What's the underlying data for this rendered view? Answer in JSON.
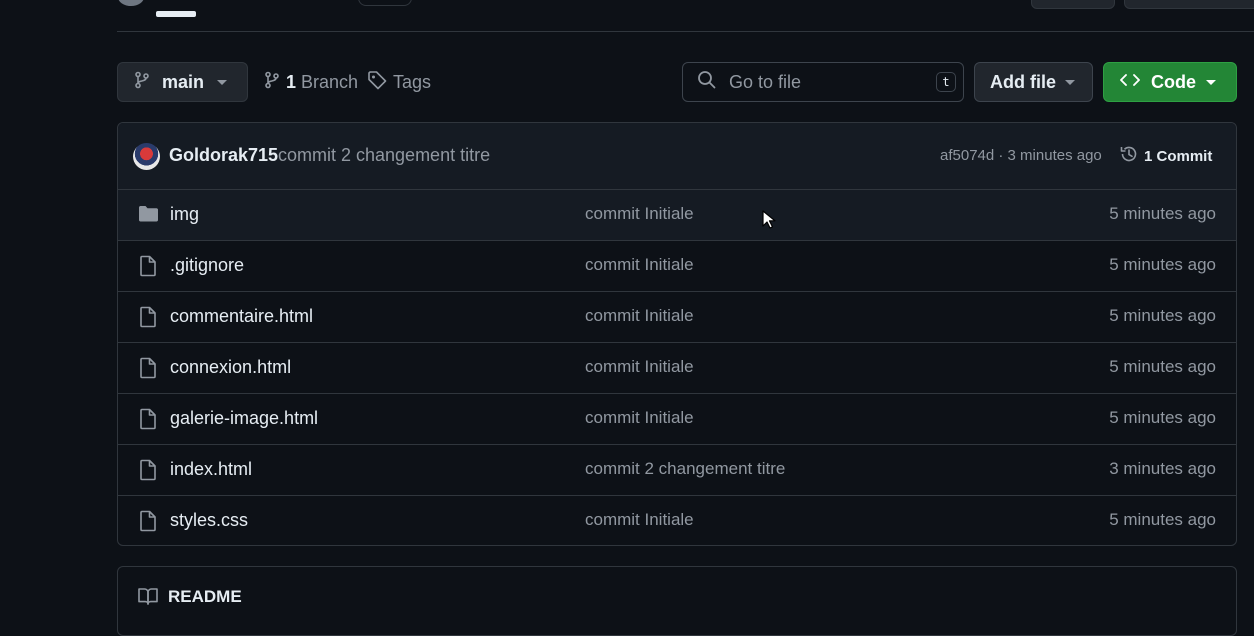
{
  "toolbar": {
    "branch": "main",
    "branches_count": "1",
    "branches_label": "Branch",
    "tags_label": "Tags",
    "search_placeholder": "Go to file",
    "search_shortcut": "t",
    "add_file_label": "Add file",
    "code_label": "Code"
  },
  "latest_commit": {
    "author": "Goldorak715",
    "message": "commit 2 changement titre",
    "hash_time": "af5074d · 3 minutes ago",
    "commits_count": "1 Commit"
  },
  "files": [
    {
      "name": "img",
      "type": "folder",
      "message": "commit Initiale",
      "age": "5 minutes ago"
    },
    {
      "name": ".gitignore",
      "type": "file",
      "message": "commit Initiale",
      "age": "5 minutes ago"
    },
    {
      "name": "commentaire.html",
      "type": "file",
      "message": "commit Initiale",
      "age": "5 minutes ago"
    },
    {
      "name": "connexion.html",
      "type": "file",
      "message": "commit Initiale",
      "age": "5 minutes ago"
    },
    {
      "name": "galerie-image.html",
      "type": "file",
      "message": "commit Initiale",
      "age": "5 minutes ago"
    },
    {
      "name": "index.html",
      "type": "file",
      "message": "commit 2 changement titre",
      "age": "3 minutes ago"
    },
    {
      "name": "styles.css",
      "type": "file",
      "message": "commit Initiale",
      "age": "5 minutes ago"
    }
  ],
  "readme": {
    "title": "README"
  },
  "colors": {
    "background": "#0d1117",
    "border": "#30363d",
    "code_button": "#238636",
    "muted_text": "#9198a1",
    "text": "#e6edf3"
  },
  "icons": [
    "git-branch-icon",
    "tag-icon",
    "search-icon",
    "code-icon",
    "history-icon",
    "folder-icon",
    "file-icon",
    "book-icon",
    "mouse-cursor-icon"
  ]
}
